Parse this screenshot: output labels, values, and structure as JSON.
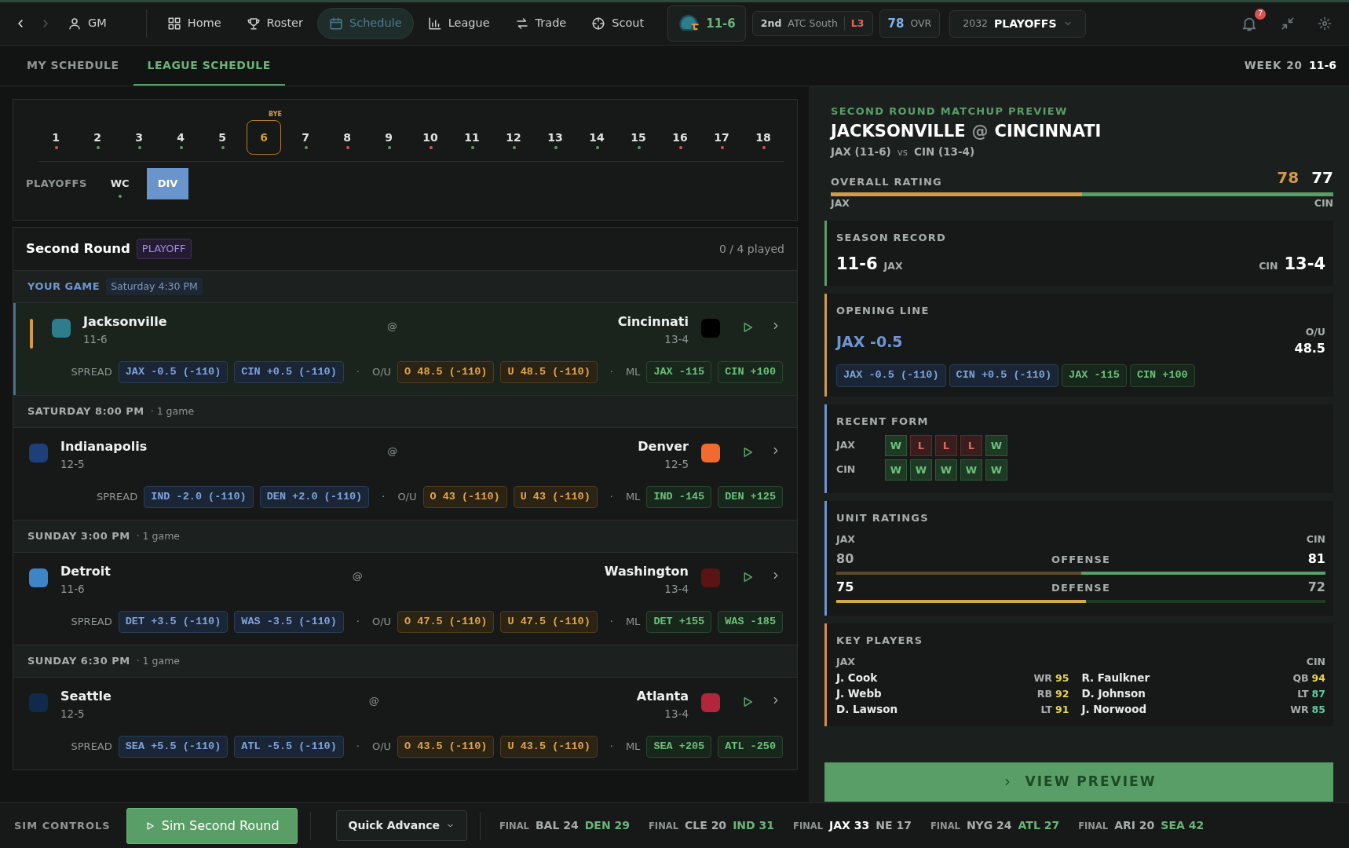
{
  "nav": {
    "items": [
      {
        "label": "GM",
        "selected": false
      },
      {
        "label": "Home",
        "selected": false
      },
      {
        "label": "Roster",
        "selected": false
      },
      {
        "label": "Schedule",
        "selected": true
      },
      {
        "label": "League",
        "selected": false
      },
      {
        "label": "Trade",
        "selected": false
      },
      {
        "label": "Scout",
        "selected": false
      }
    ],
    "team_record": "11-6",
    "standing": {
      "place": "2nd",
      "division": "ATC South",
      "streak": "L3"
    },
    "ovr": {
      "value": "78",
      "label": "OVR"
    },
    "season": {
      "year": "2032",
      "phase": "PLAYOFFS"
    },
    "notifications": "7"
  },
  "tabs": [
    {
      "label": "MY SCHEDULE",
      "selected": false
    },
    {
      "label": "LEAGUE SCHEDULE",
      "selected": true
    }
  ],
  "week_label": "WEEK 20",
  "record": "11-6",
  "weeks": [
    {
      "label": "1",
      "color": "#d9534f",
      "selected": false
    },
    {
      "label": "2",
      "color": "#5a9e67",
      "selected": false
    },
    {
      "label": "3",
      "color": "#5a9e67",
      "selected": false
    },
    {
      "label": "4",
      "color": "#5a9e67",
      "selected": false
    },
    {
      "label": "5",
      "color": "#5a9e67",
      "selected": false
    },
    {
      "label": "6",
      "note": "BYE",
      "selected": true
    },
    {
      "label": "7",
      "color": "#5a9e67",
      "selected": false
    },
    {
      "label": "8",
      "color": "#d9534f",
      "selected": false
    },
    {
      "label": "9",
      "color": "#5a9e67",
      "selected": false
    },
    {
      "label": "10",
      "color": "#d9534f",
      "selected": false
    },
    {
      "label": "11",
      "color": "#5a9e67",
      "selected": false
    },
    {
      "label": "12",
      "color": "#5a9e67",
      "selected": false
    },
    {
      "label": "13",
      "color": "#5a9e67",
      "selected": false
    },
    {
      "label": "14",
      "color": "#5a9e67",
      "selected": false
    },
    {
      "label": "15",
      "color": "#5a9e67",
      "selected": false
    },
    {
      "label": "16",
      "color": "#d9534f",
      "selected": false
    },
    {
      "label": "17",
      "color": "#d9534f",
      "selected": false
    },
    {
      "label": "18",
      "color": "#d9534f",
      "selected": false
    }
  ],
  "playoff_label": "PLAYOFFS",
  "rounds": [
    {
      "label": "WC",
      "color": "#5a9e67",
      "selected": false
    },
    {
      "label": "DIV",
      "selected": true
    }
  ],
  "round": {
    "title": "Second Round",
    "tag": "PLAYOFF",
    "played": "0 / 4 played"
  },
  "slots": [
    {
      "kind": "yours",
      "title": "YOUR GAME",
      "time": "Saturday 4:30 PM",
      "game": {
        "away": {
          "name": "Jacksonville",
          "record": "11-6",
          "color": "#2e7d8c"
        },
        "at": "@",
        "home": {
          "name": "Cincinnati",
          "record": "13-4",
          "color": "#000000"
        },
        "spread_label": "SPREAD",
        "spread": [
          "JAX -0.5 (-110)",
          "CIN +0.5 (-110)"
        ],
        "ou_label": "O/U",
        "ou": [
          "O 48.5 (-110)",
          "U 48.5 (-110)"
        ],
        "ml_label": "ML",
        "ml": [
          "JAX -115",
          "CIN +100"
        ],
        "sep": "·"
      }
    },
    {
      "kind": "time",
      "title": "SATURDAY 8:00 PM",
      "count": "· 1 game",
      "game": {
        "away": {
          "name": "Indianapolis",
          "record": "12-5",
          "color": "#1d3f7a"
        },
        "at": "@",
        "home": {
          "name": "Denver",
          "record": "12-5",
          "color": "#f26a2e"
        },
        "spread_label": "SPREAD",
        "spread": [
          "IND -2.0 (-110)",
          "DEN +2.0 (-110)"
        ],
        "ou_label": "O/U",
        "ou": [
          "O 43 (-110)",
          "U 43 (-110)"
        ],
        "ml_label": "ML",
        "ml": [
          "IND -145",
          "DEN +125"
        ],
        "sep": "·"
      }
    },
    {
      "kind": "time",
      "title": "SUNDAY 3:00 PM",
      "count": "· 1 game",
      "game": {
        "away": {
          "name": "Detroit",
          "record": "11-6",
          "color": "#3d85c6"
        },
        "at": "@",
        "home": {
          "name": "Washington",
          "record": "13-4",
          "color": "#5a1414"
        },
        "spread_label": "SPREAD",
        "spread": [
          "DET +3.5 (-110)",
          "WAS -3.5 (-110)"
        ],
        "ou_label": "O/U",
        "ou": [
          "O 47.5 (-110)",
          "U 47.5 (-110)"
        ],
        "ml_label": "ML",
        "ml": [
          "DET +155",
          "WAS -185"
        ],
        "sep": "·"
      }
    },
    {
      "kind": "time",
      "title": "SUNDAY 6:30 PM",
      "count": "· 1 game",
      "game": {
        "away": {
          "name": "Seattle",
          "record": "12-5",
          "color": "#0f2a4a"
        },
        "at": "@",
        "home": {
          "name": "Atlanta",
          "record": "13-4",
          "color": "#b3253a"
        },
        "spread_label": "SPREAD",
        "spread": [
          "SEA +5.5 (-110)",
          "ATL -5.5 (-110)"
        ],
        "ou_label": "O/U",
        "ou": [
          "O 43.5 (-110)",
          "U 43.5 (-110)"
        ],
        "ml_label": "ML",
        "ml": [
          "SEA +205",
          "ATL -250"
        ],
        "sep": "·"
      }
    }
  ],
  "preview": {
    "eyebrow": "SECOND ROUND MATCHUP PREVIEW",
    "away": "JACKSONVILLE",
    "at": "@",
    "home": "CINCINNATI",
    "sub_away": "JAX (11-6)",
    "vs": "vs",
    "sub_home": "CIN (13-4)",
    "overall": {
      "label": "OVERALL RATING",
      "away": "78",
      "home": "77",
      "level": 0.5,
      "away_abbr": "JAX",
      "home_abbr": "CIN"
    },
    "record_card": {
      "title": "SEASON RECORD",
      "color": "#5a9e67",
      "away": "11-6",
      "away_abbr": "JAX",
      "home_abbr": "CIN",
      "home": "13-4"
    },
    "line": {
      "title": "OPENING LINE",
      "color": "#d39a4a",
      "favorite": "JAX -0.5",
      "ou_label": "O/U",
      "ou": "48.5",
      "chips": [
        {
          "text": "JAX -0.5 (-110)",
          "kind": "spread"
        },
        {
          "text": "CIN +0.5 (-110)",
          "kind": "spread"
        },
        {
          "text": "JAX -115",
          "kind": "ml"
        },
        {
          "text": "CIN +100",
          "kind": "ml"
        }
      ]
    },
    "form": {
      "title": "RECENT FORM",
      "color": "#6f95d0",
      "teams": [
        {
          "abbr": "JAX",
          "results": [
            {
              "text": "W",
              "win": true
            },
            {
              "text": "L",
              "win": false
            },
            {
              "text": "L",
              "win": false
            },
            {
              "text": "L",
              "win": false
            },
            {
              "text": "W",
              "win": true
            }
          ]
        },
        {
          "abbr": "CIN",
          "results": [
            {
              "text": "W",
              "win": true
            },
            {
              "text": "W",
              "win": true
            },
            {
              "text": "W",
              "win": true
            },
            {
              "text": "W",
              "win": true
            },
            {
              "text": "W",
              "win": true
            }
          ]
        }
      ]
    },
    "units": {
      "title": "UNIT RATINGS",
      "color": "#6f95d0",
      "away_abbr": "JAX",
      "home_abbr": "CIN",
      "rows": [
        {
          "label": "OFFENSE",
          "away": "80",
          "home": "81",
          "level": 0.5,
          "away_leads": false
        },
        {
          "label": "DEFENSE",
          "away": "75",
          "home": "72",
          "level": 0.51,
          "away_leads": true
        }
      ]
    },
    "players": {
      "title": "KEY PLAYERS",
      "color": "#d98a4a",
      "away_abbr": "JAX",
      "home_abbr": "CIN",
      "away": [
        {
          "name": "J. Cook",
          "pos": "WR",
          "rating": "95",
          "color": "#e8d44d"
        },
        {
          "name": "J. Webb",
          "pos": "RB",
          "rating": "92",
          "color": "#e8d44d"
        },
        {
          "name": "D. Lawson",
          "pos": "LT",
          "rating": "91",
          "color": "#e8d44d"
        }
      ],
      "home": [
        {
          "name": "R. Faulkner",
          "pos": "QB",
          "rating": "94",
          "color": "#e8d44d"
        },
        {
          "name": "D. Johnson",
          "pos": "LT",
          "rating": "87",
          "color": "#5fc9a0"
        },
        {
          "name": "J. Norwood",
          "pos": "WR",
          "rating": "85",
          "color": "#5fc9a0"
        }
      ]
    },
    "button": "VIEW PREVIEW"
  },
  "footer": {
    "label": "SIM CONTROLS",
    "sim_button": "Sim Second Round",
    "advance": "Quick Advance",
    "scores": [
      {
        "status": "FINAL",
        "away": "BAL 24",
        "home": "DEN 29",
        "away_won": false,
        "mine": false
      },
      {
        "status": "FINAL",
        "away": "CLE 20",
        "home": "IND 31",
        "away_won": false,
        "mine": false
      },
      {
        "status": "FINAL",
        "away": "JAX 33",
        "home": "NE 17",
        "away_won": true,
        "mine": true
      },
      {
        "status": "FINAL",
        "away": "NYG 24",
        "home": "ATL 27",
        "away_won": false,
        "mine": false
      },
      {
        "status": "FINAL",
        "away": "ARI 20",
        "home": "SEA 42",
        "away_won": false,
        "mine": false
      }
    ]
  }
}
